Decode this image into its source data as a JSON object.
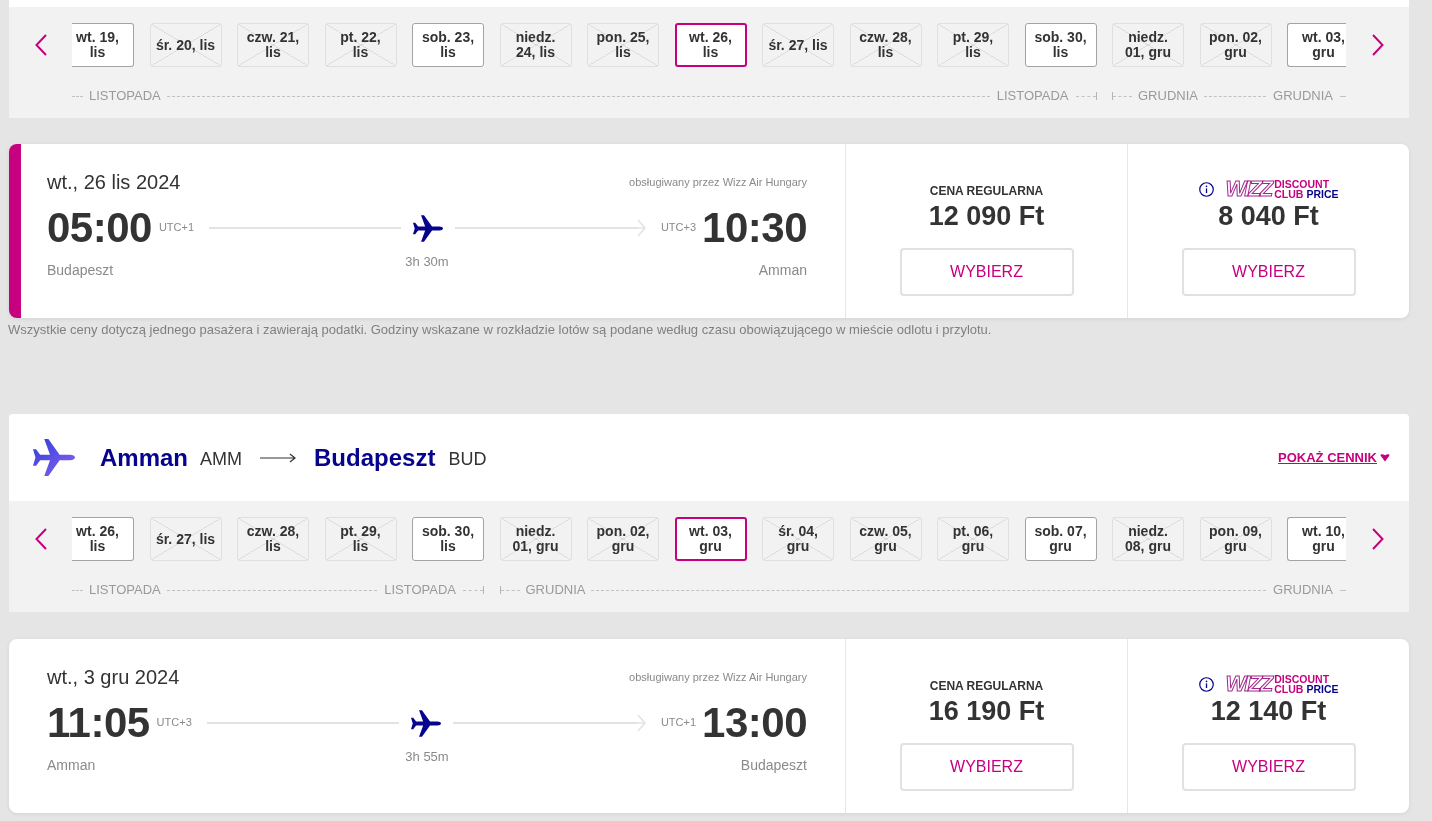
{
  "outbound": {
    "date_strip": {
      "months": [
        {
          "start_label": "LISTOPADA",
          "end_label": "LISTOPADA",
          "dates": [
            {
              "lines": [
                "wt. 19,",
                "lis"
              ],
              "available": true,
              "selected": false
            },
            {
              "lines": [
                "śr. 20, lis"
              ],
              "available": false,
              "selected": false
            },
            {
              "lines": [
                "czw. 21,",
                "lis"
              ],
              "available": false,
              "selected": false
            },
            {
              "lines": [
                "pt. 22,",
                "lis"
              ],
              "available": false,
              "selected": false
            },
            {
              "lines": [
                "sob. 23,",
                "lis"
              ],
              "available": true,
              "selected": false
            },
            {
              "lines": [
                "niedz.",
                "24, lis"
              ],
              "available": false,
              "selected": false
            },
            {
              "lines": [
                "pon. 25,",
                "lis"
              ],
              "available": false,
              "selected": false
            },
            {
              "lines": [
                "wt. 26,",
                "lis"
              ],
              "available": true,
              "selected": true
            },
            {
              "lines": [
                "śr. 27, lis"
              ],
              "available": false,
              "selected": false
            },
            {
              "lines": [
                "czw. 28,",
                "lis"
              ],
              "available": false,
              "selected": false
            },
            {
              "lines": [
                "pt. 29,",
                "lis"
              ],
              "available": false,
              "selected": false
            },
            {
              "lines": [
                "sob. 30,",
                "lis"
              ],
              "available": true,
              "selected": false
            }
          ]
        },
        {
          "start_label": "GRUDNIA",
          "end_label": "GRUDNIA",
          "dates": [
            {
              "lines": [
                "niedz.",
                "01, gru"
              ],
              "available": false,
              "selected": false
            },
            {
              "lines": [
                "pon. 02,",
                "gru"
              ],
              "available": false,
              "selected": false
            },
            {
              "lines": [
                "wt. 03,",
                "gru"
              ],
              "available": true,
              "selected": false
            }
          ]
        }
      ]
    },
    "flight": {
      "selected": true,
      "date": "wt., 26 lis 2024",
      "operator": "obsługiwany przez Wizz Air Hungary",
      "departure": {
        "time": "05:00",
        "utc": "UTC+1",
        "city": "Budapeszt"
      },
      "duration": "3h 30m",
      "arrival": {
        "time": "10:30",
        "utc": "UTC+3",
        "city": "Amman"
      },
      "regular": {
        "label": "CENA REGULARNA",
        "price": "12 090 Ft",
        "button": "WYBIERZ"
      },
      "club": {
        "wordmark": "WIZZ",
        "label_top": "DISCOUNT",
        "label_bottom": "CLUB",
        "label_accent": "PRICE",
        "price": "8 040 Ft",
        "button": "WYBIERZ"
      }
    },
    "note": "Wszystkie ceny dotyczą jednego pasażera i zawierają podatki. Godziny wskazane w rozkładzie lotów są podane według czasu obowiązującego w mieście odlotu i przylotu."
  },
  "return": {
    "route": {
      "from_city": "Amman",
      "from_code": "AMM",
      "to_city": "Budapeszt",
      "to_code": "BUD",
      "toggle": "POKAŻ CENNIK"
    },
    "date_strip": {
      "months": [
        {
          "start_label": "LISTOPADA",
          "end_label": "LISTOPADA",
          "dates": [
            {
              "lines": [
                "wt. 26,",
                "lis"
              ],
              "available": true,
              "selected": false
            },
            {
              "lines": [
                "śr. 27, lis"
              ],
              "available": false,
              "selected": false
            },
            {
              "lines": [
                "czw. 28,",
                "lis"
              ],
              "available": false,
              "selected": false
            },
            {
              "lines": [
                "pt. 29,",
                "lis"
              ],
              "available": false,
              "selected": false
            },
            {
              "lines": [
                "sob. 30,",
                "lis"
              ],
              "available": true,
              "selected": false
            }
          ]
        },
        {
          "start_label": "GRUDNIA",
          "end_label": "GRUDNIA",
          "dates": [
            {
              "lines": [
                "niedz.",
                "01, gru"
              ],
              "available": false,
              "selected": false
            },
            {
              "lines": [
                "pon. 02,",
                "gru"
              ],
              "available": false,
              "selected": false
            },
            {
              "lines": [
                "wt. 03,",
                "gru"
              ],
              "available": true,
              "selected": true
            },
            {
              "lines": [
                "śr. 04,",
                "gru"
              ],
              "available": false,
              "selected": false
            },
            {
              "lines": [
                "czw. 05,",
                "gru"
              ],
              "available": false,
              "selected": false
            },
            {
              "lines": [
                "pt. 06,",
                "gru"
              ],
              "available": false,
              "selected": false
            },
            {
              "lines": [
                "sob. 07,",
                "gru"
              ],
              "available": true,
              "selected": false
            },
            {
              "lines": [
                "niedz.",
                "08, gru"
              ],
              "available": false,
              "selected": false
            },
            {
              "lines": [
                "pon. 09,",
                "gru"
              ],
              "available": false,
              "selected": false
            },
            {
              "lines": [
                "wt. 10,",
                "gru"
              ],
              "available": true,
              "selected": false
            }
          ]
        }
      ]
    },
    "flight": {
      "selected": false,
      "date": "wt., 3 gru 2024",
      "operator": "obsługiwany przez Wizz Air Hungary",
      "departure": {
        "time": "11:05",
        "utc": "UTC+3",
        "city": "Amman"
      },
      "duration": "3h 55m",
      "arrival": {
        "time": "13:00",
        "utc": "UTC+1",
        "city": "Budapeszt"
      },
      "regular": {
        "label": "CENA REGULARNA",
        "price": "16 190 Ft",
        "button": "WYBIERZ"
      },
      "club": {
        "wordmark": "WIZZ",
        "label_top": "DISCOUNT",
        "label_bottom": "CLUB",
        "label_accent": "PRICE",
        "price": "12 140 Ft",
        "button": "WYBIERZ"
      }
    }
  }
}
